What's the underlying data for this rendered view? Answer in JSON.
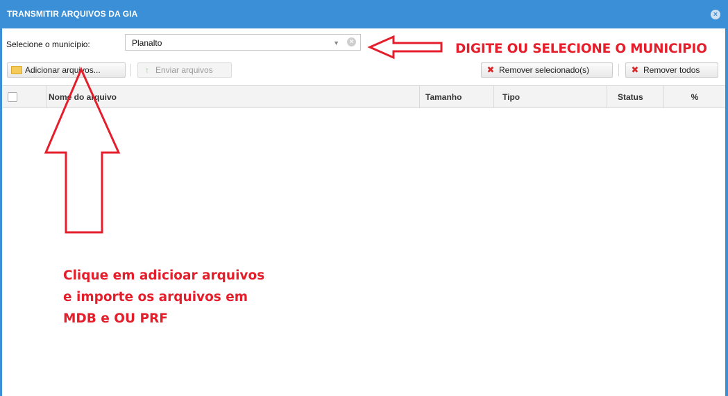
{
  "window": {
    "title": "TRANSMITIR ARQUIVOS DA GIA",
    "close_icon": "close-circle-icon"
  },
  "municipio": {
    "label": "Selecione o município:",
    "value": "Planalto"
  },
  "toolbar": {
    "add_label": "Adicionar arquivos...",
    "send_label": "Enviar arquivos",
    "remove_selected_label": "Remover selecionado(s)",
    "remove_all_label": "Remover todos"
  },
  "grid": {
    "columns": [
      "",
      "Nome do arquivo",
      "Tamanho",
      "Tipo",
      "Status",
      "%"
    ],
    "rows": []
  },
  "annotations": {
    "top": "DIGITE OU SELECIONE O MUNICIPIO",
    "bottom": "Clique em adicioar arquivos\ne importe os arquivos em\nMDB e OU PRF",
    "color": "#e41e2b"
  },
  "colors": {
    "titlebar": "#3b8fd6",
    "accent_red": "#e41e2b"
  }
}
